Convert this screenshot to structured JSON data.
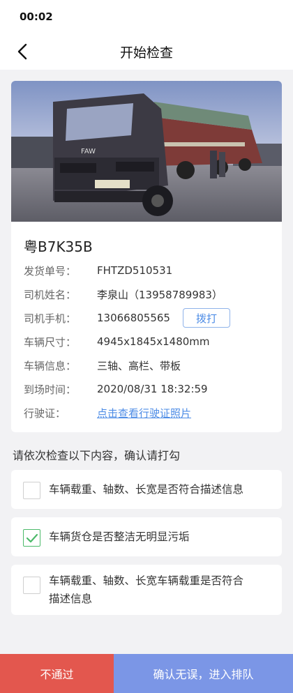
{
  "status_bar": {
    "time": "00:02"
  },
  "nav": {
    "title": "开始检查",
    "back_icon": "chevron-left-icon"
  },
  "vehicle": {
    "plate": "粤B7K35B",
    "photo_badge": "FAW",
    "rows": [
      {
        "label": "发货单号：",
        "value": "FHTZD510531"
      },
      {
        "label": "司机姓名：",
        "value": "李泉山（13958789983）"
      },
      {
        "label": "司机手机：",
        "value": "13066805565",
        "action": "拨打"
      },
      {
        "label": "车辆尺寸：",
        "value": "4945x1845x1480mm"
      },
      {
        "label": "车辆信息：",
        "value": "三轴、高栏、带板"
      },
      {
        "label": "到场时间：",
        "value": "2020/08/31 18:32:59"
      },
      {
        "label": "行驶证：",
        "link": "点击查看行驶证照片"
      }
    ]
  },
  "instruction": "请依次检查以下内容，确认请打勾",
  "checks": [
    {
      "text": "车辆载重、轴数、长宽是否符合描述信息",
      "checked": false
    },
    {
      "text": "车辆货仓是否整洁无明显污垢",
      "checked": true
    },
    {
      "text_line1": "车辆载重、轴数、长宽车辆载重是否符合",
      "text_line2": "描述信息",
      "checked": false
    }
  ],
  "buttons": {
    "reject": "不通过",
    "confirm": "确认无误，进入排队"
  },
  "colors": {
    "reject": "#e3574e",
    "confirm": "#7b96e6",
    "link": "#4d8ce6",
    "check": "#4cba6a"
  }
}
